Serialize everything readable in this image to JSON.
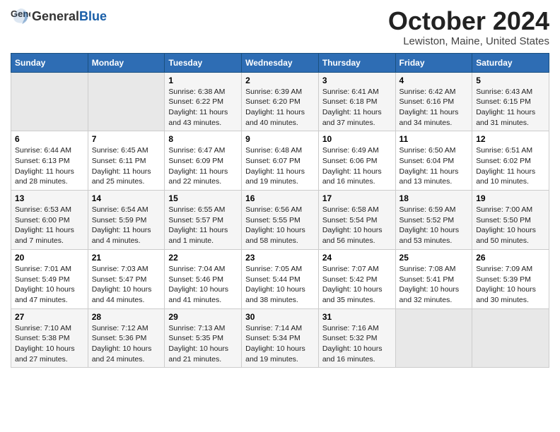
{
  "header": {
    "logo_general": "General",
    "logo_blue": "Blue",
    "month_title": "October 2024",
    "location": "Lewiston, Maine, United States"
  },
  "weekdays": [
    "Sunday",
    "Monday",
    "Tuesday",
    "Wednesday",
    "Thursday",
    "Friday",
    "Saturday"
  ],
  "weeks": [
    [
      {
        "day": "",
        "sunrise": "",
        "sunset": "",
        "daylight": ""
      },
      {
        "day": "",
        "sunrise": "",
        "sunset": "",
        "daylight": ""
      },
      {
        "day": "1",
        "sunrise": "Sunrise: 6:38 AM",
        "sunset": "Sunset: 6:22 PM",
        "daylight": "Daylight: 11 hours and 43 minutes."
      },
      {
        "day": "2",
        "sunrise": "Sunrise: 6:39 AM",
        "sunset": "Sunset: 6:20 PM",
        "daylight": "Daylight: 11 hours and 40 minutes."
      },
      {
        "day": "3",
        "sunrise": "Sunrise: 6:41 AM",
        "sunset": "Sunset: 6:18 PM",
        "daylight": "Daylight: 11 hours and 37 minutes."
      },
      {
        "day": "4",
        "sunrise": "Sunrise: 6:42 AM",
        "sunset": "Sunset: 6:16 PM",
        "daylight": "Daylight: 11 hours and 34 minutes."
      },
      {
        "day": "5",
        "sunrise": "Sunrise: 6:43 AM",
        "sunset": "Sunset: 6:15 PM",
        "daylight": "Daylight: 11 hours and 31 minutes."
      }
    ],
    [
      {
        "day": "6",
        "sunrise": "Sunrise: 6:44 AM",
        "sunset": "Sunset: 6:13 PM",
        "daylight": "Daylight: 11 hours and 28 minutes."
      },
      {
        "day": "7",
        "sunrise": "Sunrise: 6:45 AM",
        "sunset": "Sunset: 6:11 PM",
        "daylight": "Daylight: 11 hours and 25 minutes."
      },
      {
        "day": "8",
        "sunrise": "Sunrise: 6:47 AM",
        "sunset": "Sunset: 6:09 PM",
        "daylight": "Daylight: 11 hours and 22 minutes."
      },
      {
        "day": "9",
        "sunrise": "Sunrise: 6:48 AM",
        "sunset": "Sunset: 6:07 PM",
        "daylight": "Daylight: 11 hours and 19 minutes."
      },
      {
        "day": "10",
        "sunrise": "Sunrise: 6:49 AM",
        "sunset": "Sunset: 6:06 PM",
        "daylight": "Daylight: 11 hours and 16 minutes."
      },
      {
        "day": "11",
        "sunrise": "Sunrise: 6:50 AM",
        "sunset": "Sunset: 6:04 PM",
        "daylight": "Daylight: 11 hours and 13 minutes."
      },
      {
        "day": "12",
        "sunrise": "Sunrise: 6:51 AM",
        "sunset": "Sunset: 6:02 PM",
        "daylight": "Daylight: 11 hours and 10 minutes."
      }
    ],
    [
      {
        "day": "13",
        "sunrise": "Sunrise: 6:53 AM",
        "sunset": "Sunset: 6:00 PM",
        "daylight": "Daylight: 11 hours and 7 minutes."
      },
      {
        "day": "14",
        "sunrise": "Sunrise: 6:54 AM",
        "sunset": "Sunset: 5:59 PM",
        "daylight": "Daylight: 11 hours and 4 minutes."
      },
      {
        "day": "15",
        "sunrise": "Sunrise: 6:55 AM",
        "sunset": "Sunset: 5:57 PM",
        "daylight": "Daylight: 11 hours and 1 minute."
      },
      {
        "day": "16",
        "sunrise": "Sunrise: 6:56 AM",
        "sunset": "Sunset: 5:55 PM",
        "daylight": "Daylight: 10 hours and 58 minutes."
      },
      {
        "day": "17",
        "sunrise": "Sunrise: 6:58 AM",
        "sunset": "Sunset: 5:54 PM",
        "daylight": "Daylight: 10 hours and 56 minutes."
      },
      {
        "day": "18",
        "sunrise": "Sunrise: 6:59 AM",
        "sunset": "Sunset: 5:52 PM",
        "daylight": "Daylight: 10 hours and 53 minutes."
      },
      {
        "day": "19",
        "sunrise": "Sunrise: 7:00 AM",
        "sunset": "Sunset: 5:50 PM",
        "daylight": "Daylight: 10 hours and 50 minutes."
      }
    ],
    [
      {
        "day": "20",
        "sunrise": "Sunrise: 7:01 AM",
        "sunset": "Sunset: 5:49 PM",
        "daylight": "Daylight: 10 hours and 47 minutes."
      },
      {
        "day": "21",
        "sunrise": "Sunrise: 7:03 AM",
        "sunset": "Sunset: 5:47 PM",
        "daylight": "Daylight: 10 hours and 44 minutes."
      },
      {
        "day": "22",
        "sunrise": "Sunrise: 7:04 AM",
        "sunset": "Sunset: 5:46 PM",
        "daylight": "Daylight: 10 hours and 41 minutes."
      },
      {
        "day": "23",
        "sunrise": "Sunrise: 7:05 AM",
        "sunset": "Sunset: 5:44 PM",
        "daylight": "Daylight: 10 hours and 38 minutes."
      },
      {
        "day": "24",
        "sunrise": "Sunrise: 7:07 AM",
        "sunset": "Sunset: 5:42 PM",
        "daylight": "Daylight: 10 hours and 35 minutes."
      },
      {
        "day": "25",
        "sunrise": "Sunrise: 7:08 AM",
        "sunset": "Sunset: 5:41 PM",
        "daylight": "Daylight: 10 hours and 32 minutes."
      },
      {
        "day": "26",
        "sunrise": "Sunrise: 7:09 AM",
        "sunset": "Sunset: 5:39 PM",
        "daylight": "Daylight: 10 hours and 30 minutes."
      }
    ],
    [
      {
        "day": "27",
        "sunrise": "Sunrise: 7:10 AM",
        "sunset": "Sunset: 5:38 PM",
        "daylight": "Daylight: 10 hours and 27 minutes."
      },
      {
        "day": "28",
        "sunrise": "Sunrise: 7:12 AM",
        "sunset": "Sunset: 5:36 PM",
        "daylight": "Daylight: 10 hours and 24 minutes."
      },
      {
        "day": "29",
        "sunrise": "Sunrise: 7:13 AM",
        "sunset": "Sunset: 5:35 PM",
        "daylight": "Daylight: 10 hours and 21 minutes."
      },
      {
        "day": "30",
        "sunrise": "Sunrise: 7:14 AM",
        "sunset": "Sunset: 5:34 PM",
        "daylight": "Daylight: 10 hours and 19 minutes."
      },
      {
        "day": "31",
        "sunrise": "Sunrise: 7:16 AM",
        "sunset": "Sunset: 5:32 PM",
        "daylight": "Daylight: 10 hours and 16 minutes."
      },
      {
        "day": "",
        "sunrise": "",
        "sunset": "",
        "daylight": ""
      },
      {
        "day": "",
        "sunrise": "",
        "sunset": "",
        "daylight": ""
      }
    ]
  ]
}
